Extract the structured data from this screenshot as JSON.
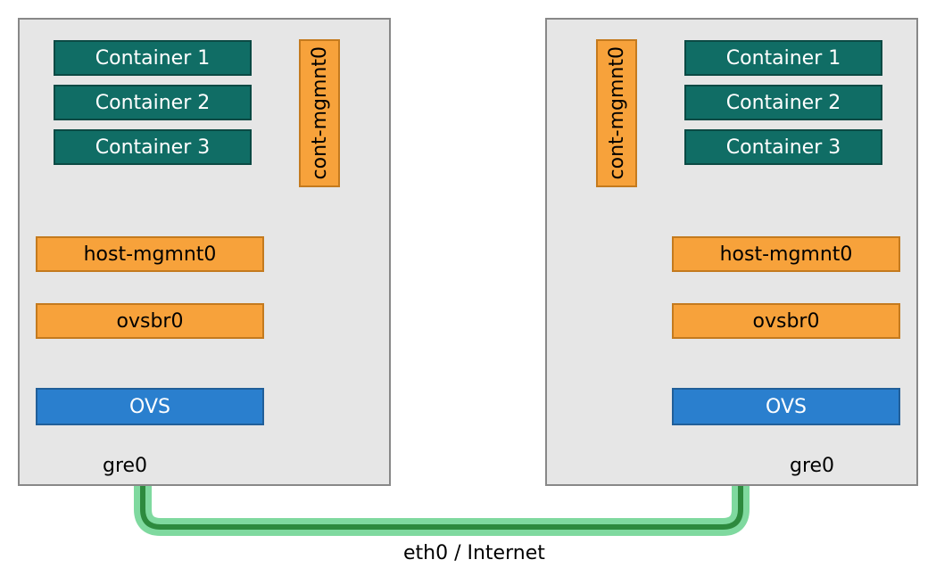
{
  "hostA": {
    "containers": [
      "Container 1",
      "Container 2",
      "Container 3"
    ],
    "cont_mgmnt": "cont-mgmnt0",
    "host_mgmnt": "host-mgmnt0",
    "ovsbr": "ovsbr0",
    "ovs": "OVS",
    "gre": "gre0"
  },
  "hostB": {
    "containers": [
      "Container 1",
      "Container 2",
      "Container 3"
    ],
    "cont_mgmnt": "cont-mgmnt0",
    "host_mgmnt": "host-mgmnt0",
    "ovsbr": "ovsbr0",
    "ovs": "OVS",
    "gre": "gre0"
  },
  "tunnel_label": "eth0 / Internet"
}
